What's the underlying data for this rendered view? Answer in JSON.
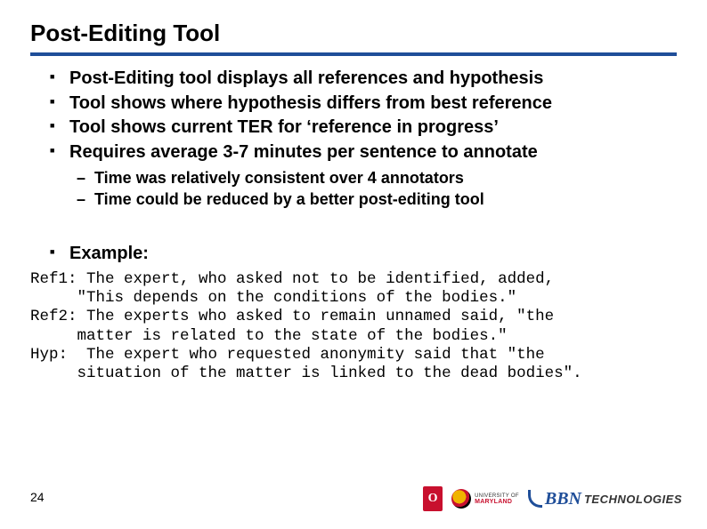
{
  "title": "Post-Editing Tool",
  "bullets": [
    "Post-Editing tool displays all references and hypothesis",
    "Tool shows where hypothesis differs from best reference",
    "Tool shows current TER for ‘reference in progress’",
    "Requires average 3-7 minutes per sentence to annotate"
  ],
  "sub_bullets": [
    "Time was relatively consistent over 4 annotators",
    "Time could be reduced by a better post-editing tool"
  ],
  "example_label": "Example:",
  "example_text": "Ref1: The expert, who asked not to be identified, added,\n     \"This depends on the conditions of the bodies.\"\nRef2: The experts who asked to remain unnamed said, \"the\n     matter is related to the state of the bodies.\"\nHyp:  The expert who requested anonymity said that \"the\n     situation of the matter is linked to the dead bodies\".",
  "page_number": "24",
  "logos": {
    "ohio_glyph": "O",
    "umd_line1": "UNIVERSITY OF",
    "umd_line2": "MARYLAND",
    "bbn_b": "BBN",
    "bbn_t": "TECHNOLOGIES"
  }
}
